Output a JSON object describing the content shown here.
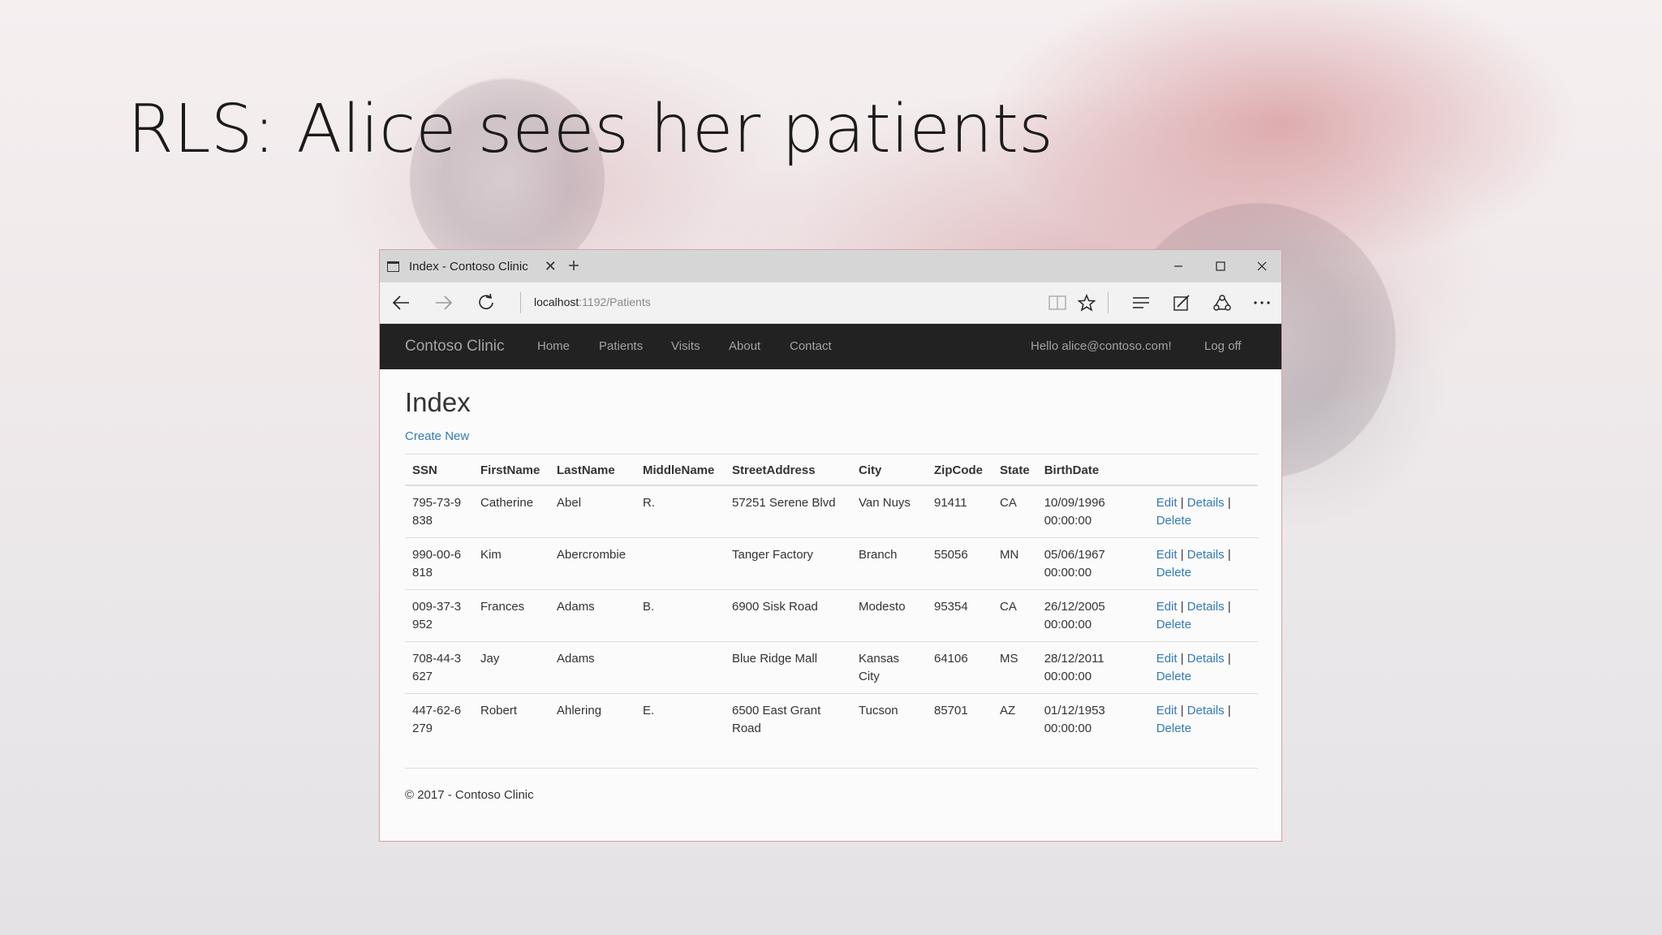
{
  "slide": {
    "title": "RLS: Alice sees her patients"
  },
  "browser": {
    "tab_title": "Index - Contoso Clinic",
    "url_host": "localhost",
    "url_path": ":1192/Patients"
  },
  "site": {
    "brand": "Contoso Clinic",
    "nav": [
      "Home",
      "Patients",
      "Visits",
      "About",
      "Contact"
    ],
    "greeting": "Hello alice@contoso.com!",
    "logoff": "Log off"
  },
  "page": {
    "heading": "Index",
    "create_new": "Create New",
    "footer": "© 2017 - Contoso Clinic"
  },
  "table": {
    "headers": [
      "SSN",
      "FirstName",
      "LastName",
      "MiddleName",
      "StreetAddress",
      "City",
      "ZipCode",
      "State",
      "BirthDate"
    ],
    "actions": {
      "edit": "Edit",
      "details": "Details",
      "delete": "Delete",
      "sep": "|"
    },
    "rows": [
      [
        "795-73-9838",
        "Catherine",
        "Abel",
        "R.",
        "57251 Serene Blvd",
        "Van Nuys",
        "91411",
        "CA",
        "10/09/1996 00:00:00"
      ],
      [
        "990-00-6818",
        "Kim",
        "Abercrombie",
        "",
        "Tanger Factory",
        "Branch",
        "55056",
        "MN",
        "05/06/1967 00:00:00"
      ],
      [
        "009-37-3952",
        "Frances",
        "Adams",
        "B.",
        "6900 Sisk Road",
        "Modesto",
        "95354",
        "CA",
        "26/12/2005 00:00:00"
      ],
      [
        "708-44-3627",
        "Jay",
        "Adams",
        "",
        "Blue Ridge Mall",
        "Kansas City",
        "64106",
        "MS",
        "28/12/2011 00:00:00"
      ],
      [
        "447-62-6279",
        "Robert",
        "Ahlering",
        "E.",
        "6500 East Grant Road",
        "Tucson",
        "85701",
        "AZ",
        "01/12/1953 00:00:00"
      ]
    ]
  },
  "colors": {
    "link": "#337ab7",
    "navbar": "#222222",
    "accent_border": "#d9a0a4"
  }
}
